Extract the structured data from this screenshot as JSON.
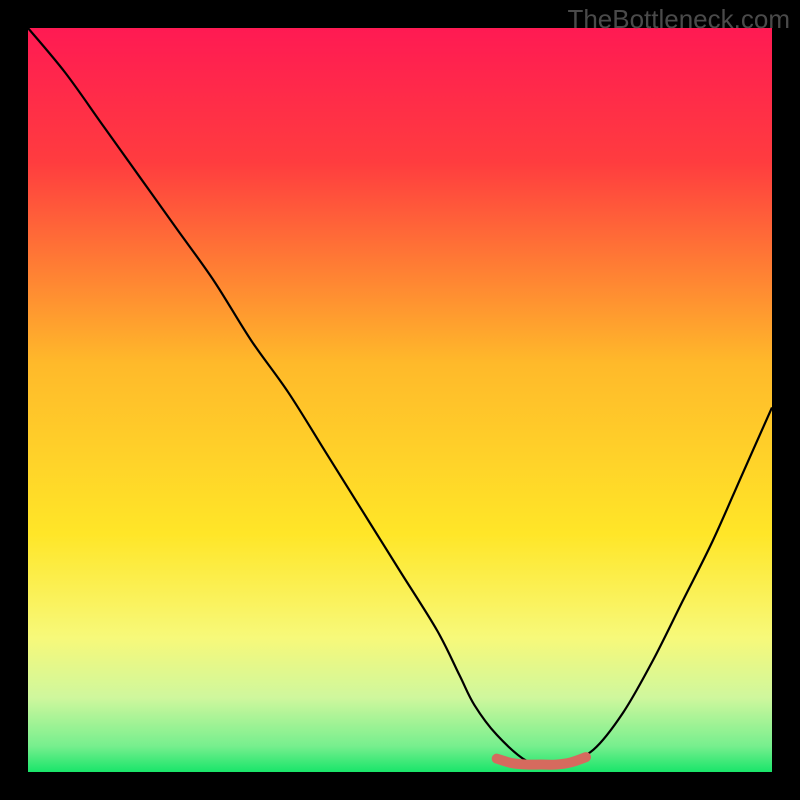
{
  "watermark": "TheBottleneck.com",
  "colors": {
    "frame": "#000000",
    "gradient_stops": [
      {
        "offset": 0.0,
        "color": "#ff1a53"
      },
      {
        "offset": 0.18,
        "color": "#ff3c3f"
      },
      {
        "offset": 0.45,
        "color": "#ffb92a"
      },
      {
        "offset": 0.68,
        "color": "#ffe628"
      },
      {
        "offset": 0.82,
        "color": "#f7f97a"
      },
      {
        "offset": 0.9,
        "color": "#cff79d"
      },
      {
        "offset": 0.965,
        "color": "#77ef8e"
      },
      {
        "offset": 1.0,
        "color": "#19e56a"
      }
    ],
    "curve": "#000000",
    "marker_fill": "#d66a5e",
    "marker_stroke": "#d66a5e"
  },
  "chart_data": {
    "type": "line",
    "title": "",
    "xlabel": "",
    "ylabel": "",
    "xlim": [
      0,
      100
    ],
    "ylim": [
      0,
      100
    ],
    "series": [
      {
        "name": "bottleneck-curve",
        "x": [
          0,
          5,
          10,
          15,
          20,
          25,
          30,
          35,
          40,
          45,
          50,
          55,
          58,
          60,
          63,
          67,
          70,
          72,
          76,
          80,
          84,
          88,
          92,
          96,
          100
        ],
        "y": [
          100,
          94,
          87,
          80,
          73,
          66,
          58,
          51,
          43,
          35,
          27,
          19,
          13,
          9,
          5,
          1.5,
          1,
          1,
          3,
          8,
          15,
          23,
          31,
          40,
          49
        ]
      }
    ],
    "marker": {
      "name": "optimal-range",
      "x": [
        63,
        65,
        67,
        69,
        71,
        73,
        75
      ],
      "y": [
        1.8,
        1.2,
        1.0,
        1.0,
        1.0,
        1.3,
        2.0
      ]
    }
  }
}
